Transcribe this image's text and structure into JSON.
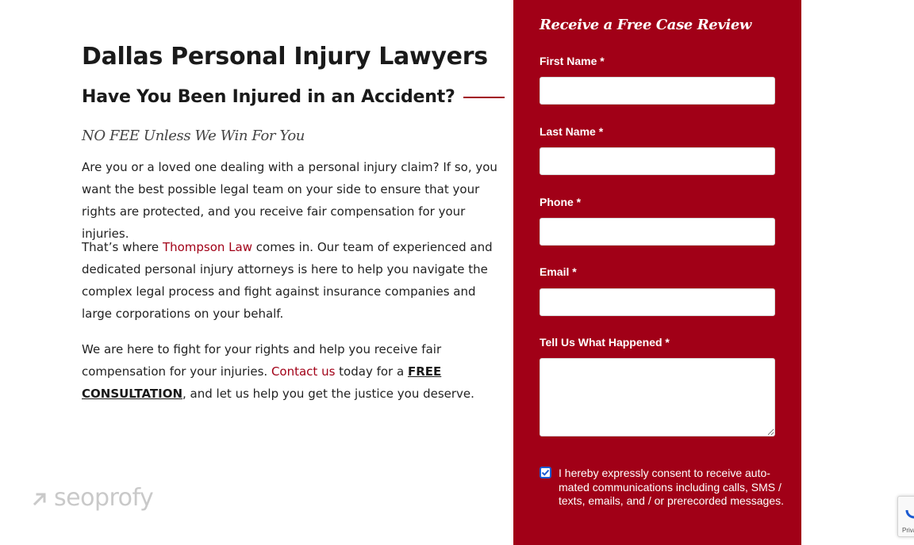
{
  "colors": {
    "brand_red": "#a10017",
    "text_dark": "#1a1a1a",
    "checkbox_blue": "#1c5bd1",
    "watermark_gray": "#c9c9c9"
  },
  "content": {
    "title": "Dallas Personal Injury Lawyers",
    "subtitle": "Have You Been Injured in an Accident?",
    "tagline": "NO FEE Unless We Win For You",
    "p1": "Are you or a loved one dealing with a personal injury claim? If so, you want the best possible legal team on your side to ensure that your rights are protected, and you receive fair compensation for your injuries.",
    "p2_before": "That’s where ",
    "p2_link": "Thompson Law",
    "p2_after": " comes in. Our team of experienced and dedicated personal injury attorneys is here to help you navigate the complex legal process and fight against insurance companies and large corporations on your behalf.",
    "p3_before": "We are here to fight for your rights and help you receive fair compensation for your injuries. ",
    "p3_link": "Contact us",
    "p3_middle": " today for a ",
    "p3_strong": "FREE CONSULTATION",
    "p3_after": ", and let us help you get the justice you deserve."
  },
  "form": {
    "title": "Receive a Free Case Review",
    "first_name_label": "First Name *",
    "first_name_value": "",
    "last_name_label": "Last Name *",
    "last_name_value": "",
    "phone_label": "Phone *",
    "phone_value": "",
    "email_label": "Email *",
    "email_value": "",
    "message_label": "Tell Us What Happened *",
    "message_value": "",
    "consent_checked": true,
    "consent_text": "I hereby expressly consent to receive auto-mated communications including calls, SMS / texts, emails, and / or prerecorded messages."
  },
  "watermark": {
    "text": "seoprofy",
    "icon": "arrow-up-right-icon"
  },
  "recaptcha": {
    "text": "Priva",
    "icon": "recaptcha-icon"
  }
}
